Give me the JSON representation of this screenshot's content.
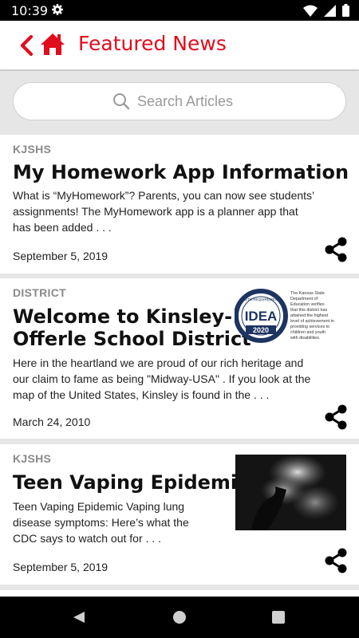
{
  "status_bar": {
    "time": "10:39"
  },
  "header": {
    "title": "Featured News"
  },
  "search": {
    "placeholder": "Search Articles"
  },
  "articles": [
    {
      "category": "KJSHS",
      "title": "My Homework App Information",
      "excerpt_lines": [
        "What is “MyHomework”? Parents, you can now see students’",
        "assignments!   The MyHomework app is a planner app that",
        "has been added . . ."
      ],
      "date": "September 5, 2019"
    },
    {
      "category": "DISTRICT",
      "title_lines": [
        "Welcome to Kinsley-",
        "Offerle School District"
      ],
      "excerpt_lines": [
        " Here in the heartland we are proud of our rich heritage and",
        "our claim to fame as being \"Midway-USA\" . If you look at the",
        "map of the United States, Kinsley is found in the . . ."
      ],
      "date": "March 24, 2010",
      "image": {
        "badge_top": "MEETS REQUIREMENTS",
        "badge_word": "IDEA",
        "badge_year": "2020",
        "caption_lines": [
          "The Kansas State",
          "Department of",
          "Education verifies",
          "that this district has",
          "attained the highest",
          "level of achievement in",
          "providing services to",
          "children and youth",
          "with disabilities."
        ]
      }
    },
    {
      "category": "KJSHS",
      "title": "Teen Vaping Epidemic",
      "excerpt_lines": [
        "Teen Vaping Epidemic Vaping lung",
        "disease symptoms: Here’s what the",
        "CDC says to watch out for    . . ."
      ],
      "date": "September 5, 2019"
    }
  ],
  "colors": {
    "brand_red": "#e00d1d",
    "idea_navy": "#1d3461"
  },
  "icons": [
    "gear-icon",
    "wifi-icon",
    "signal-icon",
    "battery-icon",
    "back-chevron-icon",
    "home-icon",
    "search-icon",
    "share-icon",
    "nav-back-icon",
    "nav-home-icon",
    "nav-recents-icon"
  ]
}
